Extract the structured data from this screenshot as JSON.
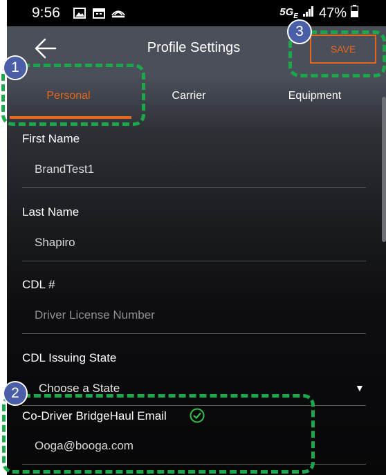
{
  "status_bar": {
    "time": "9:56",
    "network": "5G",
    "network_sub": "E",
    "battery": "47%"
  },
  "app_bar": {
    "title": "Profile Settings",
    "save_label": "SAVE"
  },
  "tabs": [
    {
      "label": "Personal",
      "active": true
    },
    {
      "label": "Carrier",
      "active": false
    },
    {
      "label": "Equipment",
      "active": false
    }
  ],
  "form": {
    "first_name": {
      "label": "First Name",
      "value": "BrandTest1"
    },
    "last_name": {
      "label": "Last Name",
      "value": "Shapiro"
    },
    "cdl": {
      "label": "CDL #",
      "placeholder": "Driver License Number"
    },
    "cdl_state": {
      "label": "CDL Issuing State",
      "value": "Choose a State"
    },
    "codriver_email": {
      "label": "Co-Driver BridgeHaul Email",
      "value": "Ooga@booga.com",
      "verified": true
    }
  },
  "annotations": [
    {
      "number": "1"
    },
    {
      "number": "2"
    },
    {
      "number": "3"
    }
  ],
  "colors": {
    "accent": "#e8671c",
    "annotation_green": "#1aa84a",
    "badge_blue": "#4a5fa8"
  }
}
